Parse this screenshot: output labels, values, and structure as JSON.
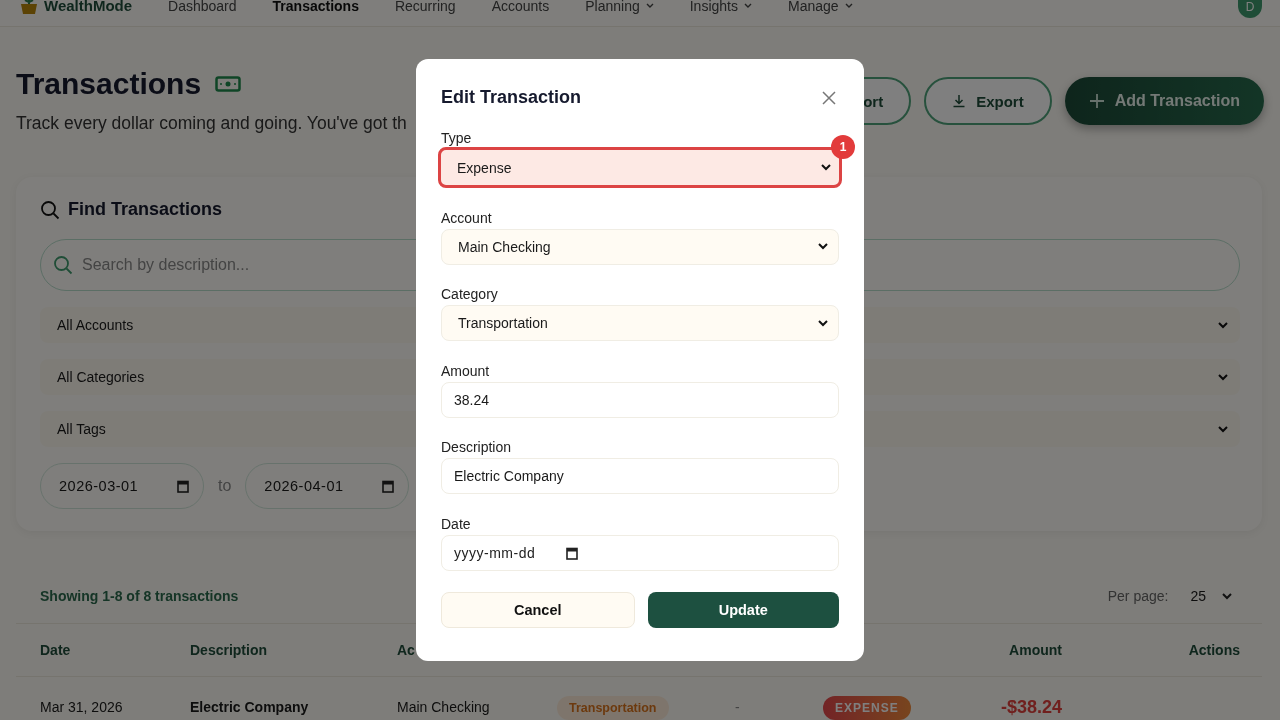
{
  "nav": {
    "brand": "WealthMode",
    "avatar": "D",
    "items": [
      {
        "label": "Dashboard",
        "selected": false,
        "dropdown": false
      },
      {
        "label": "Transactions",
        "selected": true,
        "dropdown": false
      },
      {
        "label": "Recurring",
        "selected": false,
        "dropdown": false
      },
      {
        "label": "Accounts",
        "selected": false,
        "dropdown": false
      },
      {
        "label": "Planning",
        "selected": false,
        "dropdown": true
      },
      {
        "label": "Insights",
        "selected": false,
        "dropdown": true
      },
      {
        "label": "Manage",
        "selected": false,
        "dropdown": true
      }
    ]
  },
  "header": {
    "title": "Transactions",
    "subtitle": "Track every dollar coming and going. You've got th",
    "buttons": [
      {
        "label": "ort",
        "kind": "outline"
      },
      {
        "label": "Export",
        "kind": "export"
      },
      {
        "label": "Add Transaction",
        "kind": "primary"
      }
    ]
  },
  "filters": {
    "title": "Find Transactions",
    "search": {
      "placeholder": "Search by description..."
    },
    "selects": [
      "All Accounts",
      "All Categories",
      "All Tags"
    ],
    "date_from": "2026-03-01",
    "date_separator": "to",
    "date_to": "2026-04-01"
  },
  "results": {
    "summary": "Showing 1-8 of 8 transactions",
    "per_page_label": "Per page:",
    "per_page": "25"
  },
  "table": {
    "columns": [
      "Date",
      "Description",
      "Ac",
      "Amount",
      "Actions"
    ],
    "rows": [
      {
        "kind": "expense",
        "date": "Mar 31, 2026",
        "description": "Electric Company",
        "account": "Main Checking",
        "category": "Transportation",
        "tags": "-",
        "type": "EXPENSE",
        "amount": "-$38.24"
      }
    ]
  },
  "modal": {
    "title": "Edit Transaction",
    "fields": [
      {
        "label": "Type",
        "kind": "select",
        "value": "Expense",
        "highlighted": true,
        "badge": "1"
      },
      {
        "label": "Account",
        "kind": "select",
        "value": "Main Checking",
        "highlighted": false
      },
      {
        "label": "Category",
        "kind": "select",
        "value": "Transportation",
        "highlighted": false
      },
      {
        "label": "Amount",
        "kind": "input",
        "value": "38.24",
        "highlighted": false
      },
      {
        "label": "Description",
        "kind": "input",
        "value": "Electric Company",
        "highlighted": false
      },
      {
        "label": "Date",
        "kind": "date",
        "placeholder": "yyyy-mm-dd",
        "highlighted": false
      }
    ],
    "buttons": [
      {
        "label": "Cancel",
        "kind": "secondary"
      },
      {
        "label": "Update",
        "kind": "primary"
      }
    ]
  }
}
